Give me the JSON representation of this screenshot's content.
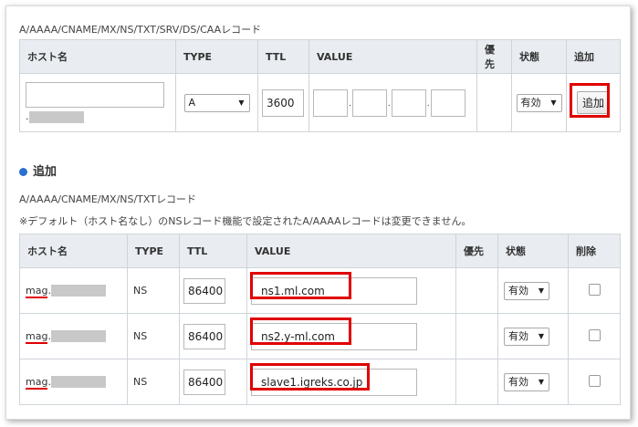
{
  "top_section": {
    "label": "A/AAAA/CNAME/MX/NS/TXT/SRV/DS/CAAレコード",
    "headers": [
      "ホスト名",
      "TYPE",
      "TTL",
      "VALUE",
      "優先",
      "状態",
      "追加"
    ],
    "host_suffix": ".",
    "type_value": "A",
    "ttl_value": "3600",
    "status_value": "有効",
    "add_button": "追加"
  },
  "add_heading": "追加",
  "bottom_section": {
    "label": "A/AAAA/CNAME/MX/NS/TXTレコード",
    "note": "※デフォルト（ホスト名なし）のNSレコード機能で設定されたA/AAAAレコードは変更できません。",
    "headers": [
      "ホスト名",
      "TYPE",
      "TTL",
      "VALUE",
      "優先",
      "状態",
      "削除"
    ],
    "rows": [
      {
        "host": "mag",
        "sep": ".",
        "type": "NS",
        "ttl": "86400",
        "value": "ns1.ml.com",
        "status": "有効"
      },
      {
        "host": "mag",
        "sep": ".",
        "type": "NS",
        "ttl": "86400",
        "value": "ns2.y-ml.com",
        "status": "有効"
      },
      {
        "host": "mag",
        "sep": ".",
        "type": "NS",
        "ttl": "86400",
        "value": "slave1.igreks.co.jp",
        "status": "有効"
      }
    ]
  },
  "colors": {
    "highlight": "#e00000",
    "header_bg": "#e9edf1",
    "bullet": "#2a6fd1"
  }
}
